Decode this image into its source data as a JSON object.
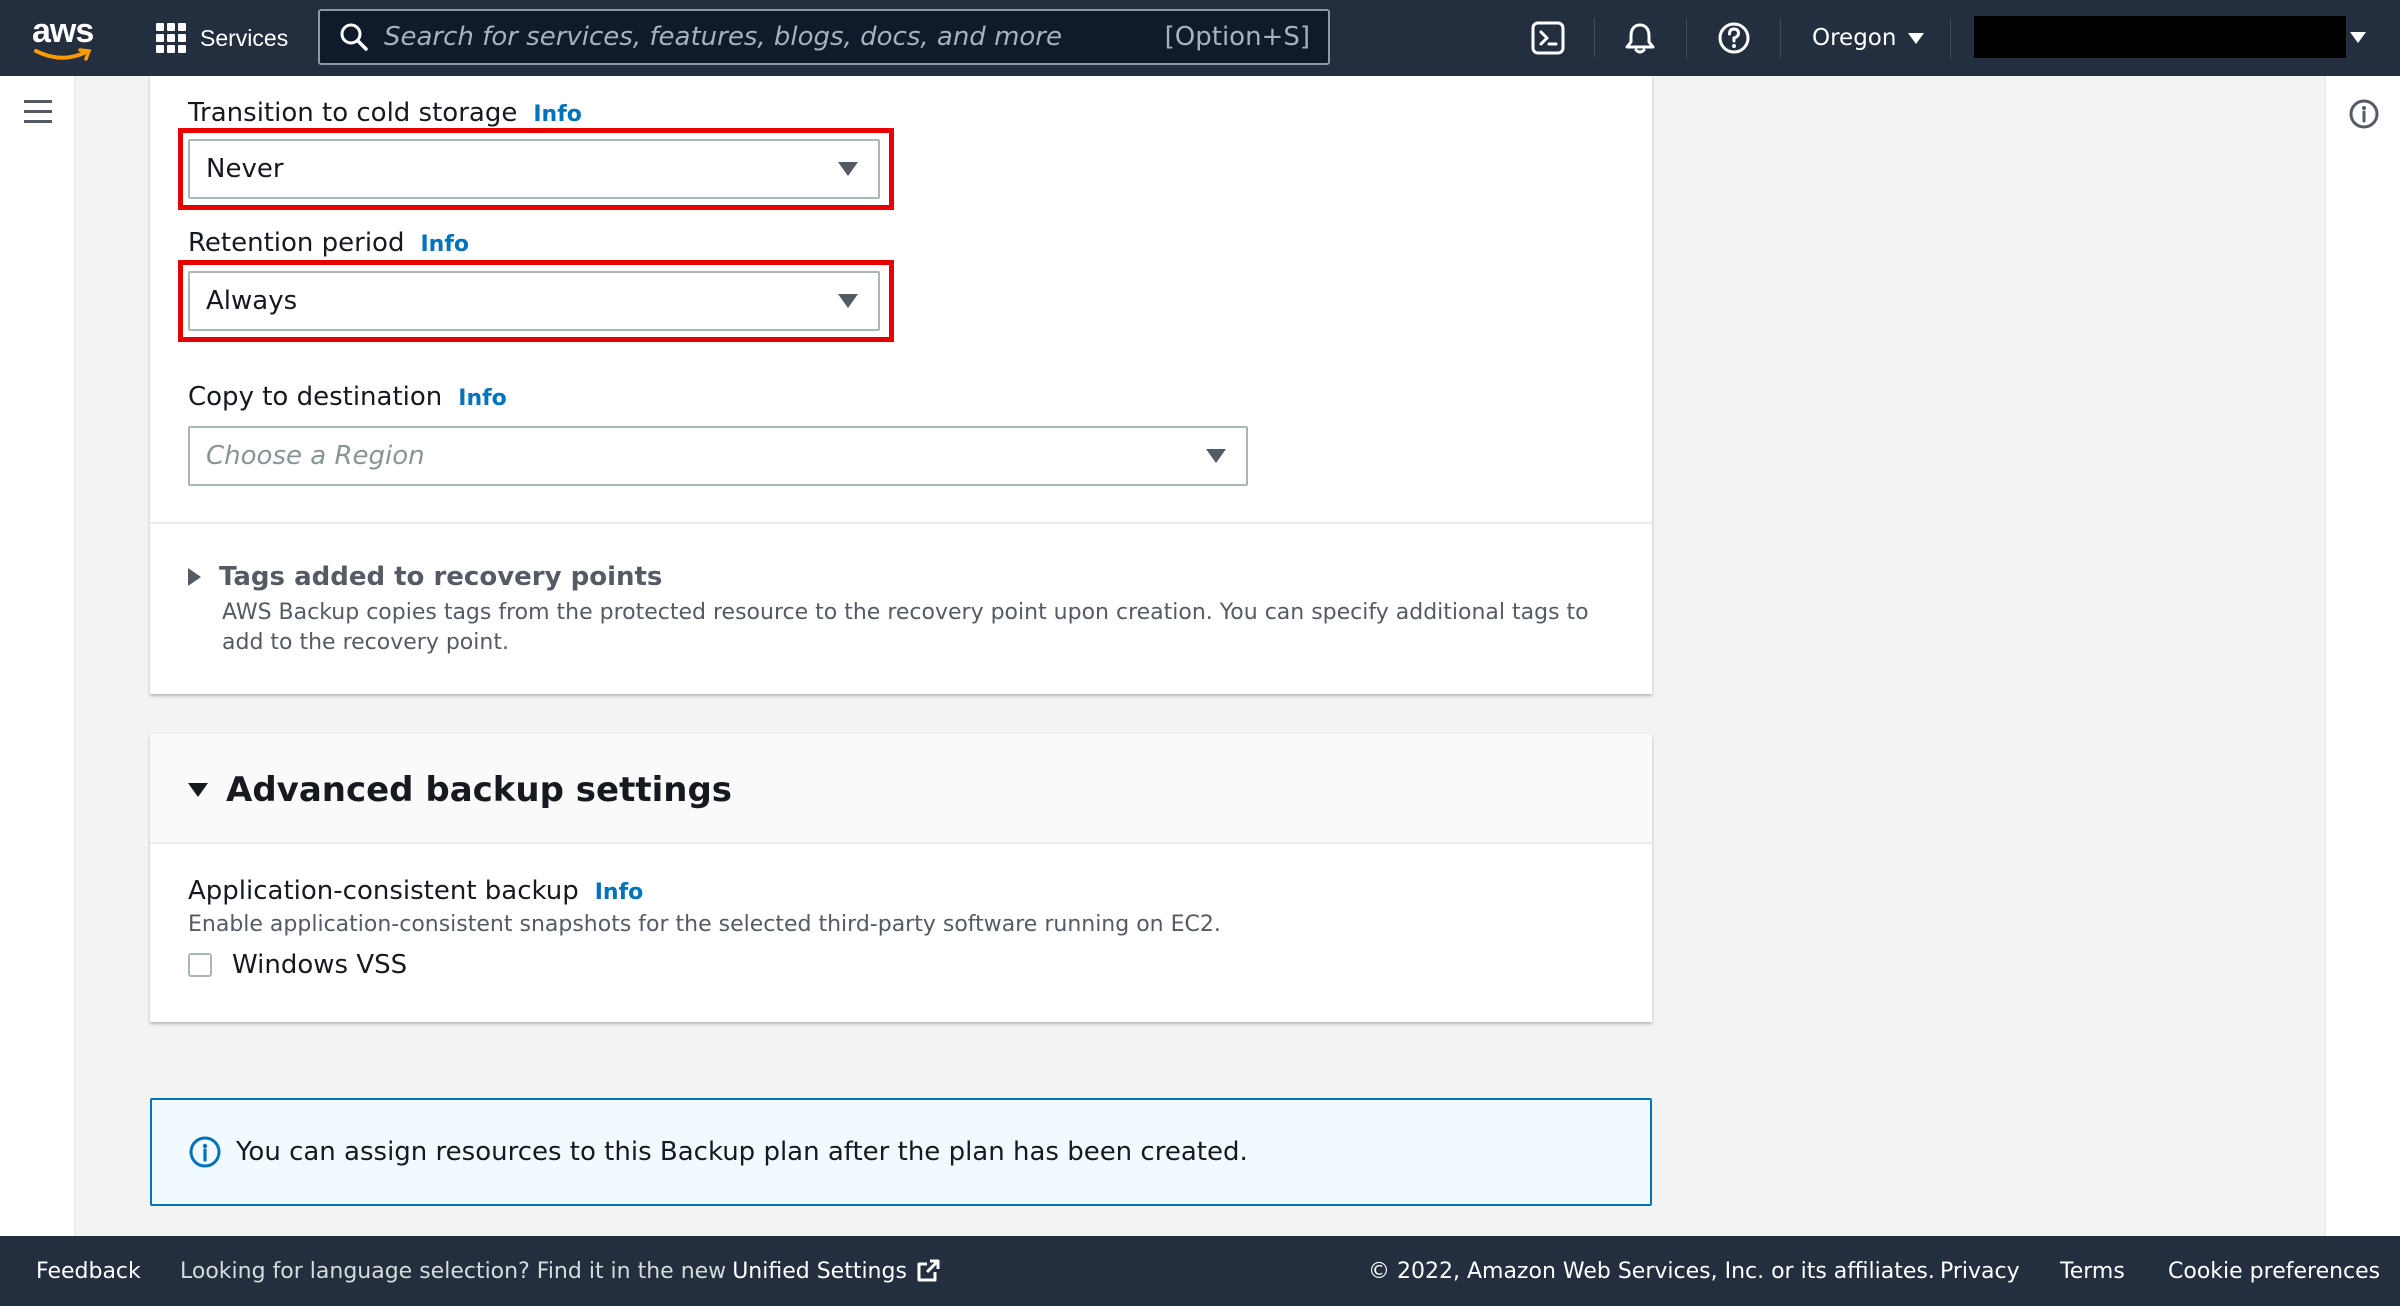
{
  "topnav": {
    "logo_text": "aws",
    "services_label": "Services",
    "search_placeholder": "Search for services, features, blogs, docs, and more",
    "search_shortcut": "[Option+S]",
    "region_label": "Oregon"
  },
  "form": {
    "cold_storage": {
      "label": "Transition to cold storage",
      "info": "Info",
      "value": "Never"
    },
    "retention": {
      "label": "Retention period",
      "info": "Info",
      "value": "Always"
    },
    "copy_destination": {
      "label": "Copy to destination",
      "info": "Info",
      "placeholder": "Choose a Region"
    },
    "tags": {
      "title": "Tags added to recovery points",
      "description": "AWS Backup copies tags from the protected resource to the recovery point upon creation. You can specify additional tags to add to the recovery point."
    }
  },
  "advanced": {
    "title": "Advanced backup settings",
    "app_consistent": {
      "label": "Application-consistent backup",
      "info": "Info",
      "description": "Enable application-consistent snapshots for the selected third-party software running on EC2.",
      "checkbox_label": "Windows VSS",
      "checked": false
    }
  },
  "alert": {
    "text": "You can assign resources to this Backup plan after the plan has been created."
  },
  "footer": {
    "feedback": "Feedback",
    "language_prompt": "Looking for language selection? Find it in the new",
    "unified_settings": "Unified Settings",
    "copyright": "© 2022, Amazon Web Services, Inc. or its affiliates.",
    "privacy": "Privacy",
    "terms": "Terms",
    "cookie_preferences": "Cookie preferences"
  },
  "colors": {
    "nav_bg": "#232f3e",
    "link": "#0073bb",
    "highlight": "#e60000",
    "alert_bg": "#f1faff"
  }
}
